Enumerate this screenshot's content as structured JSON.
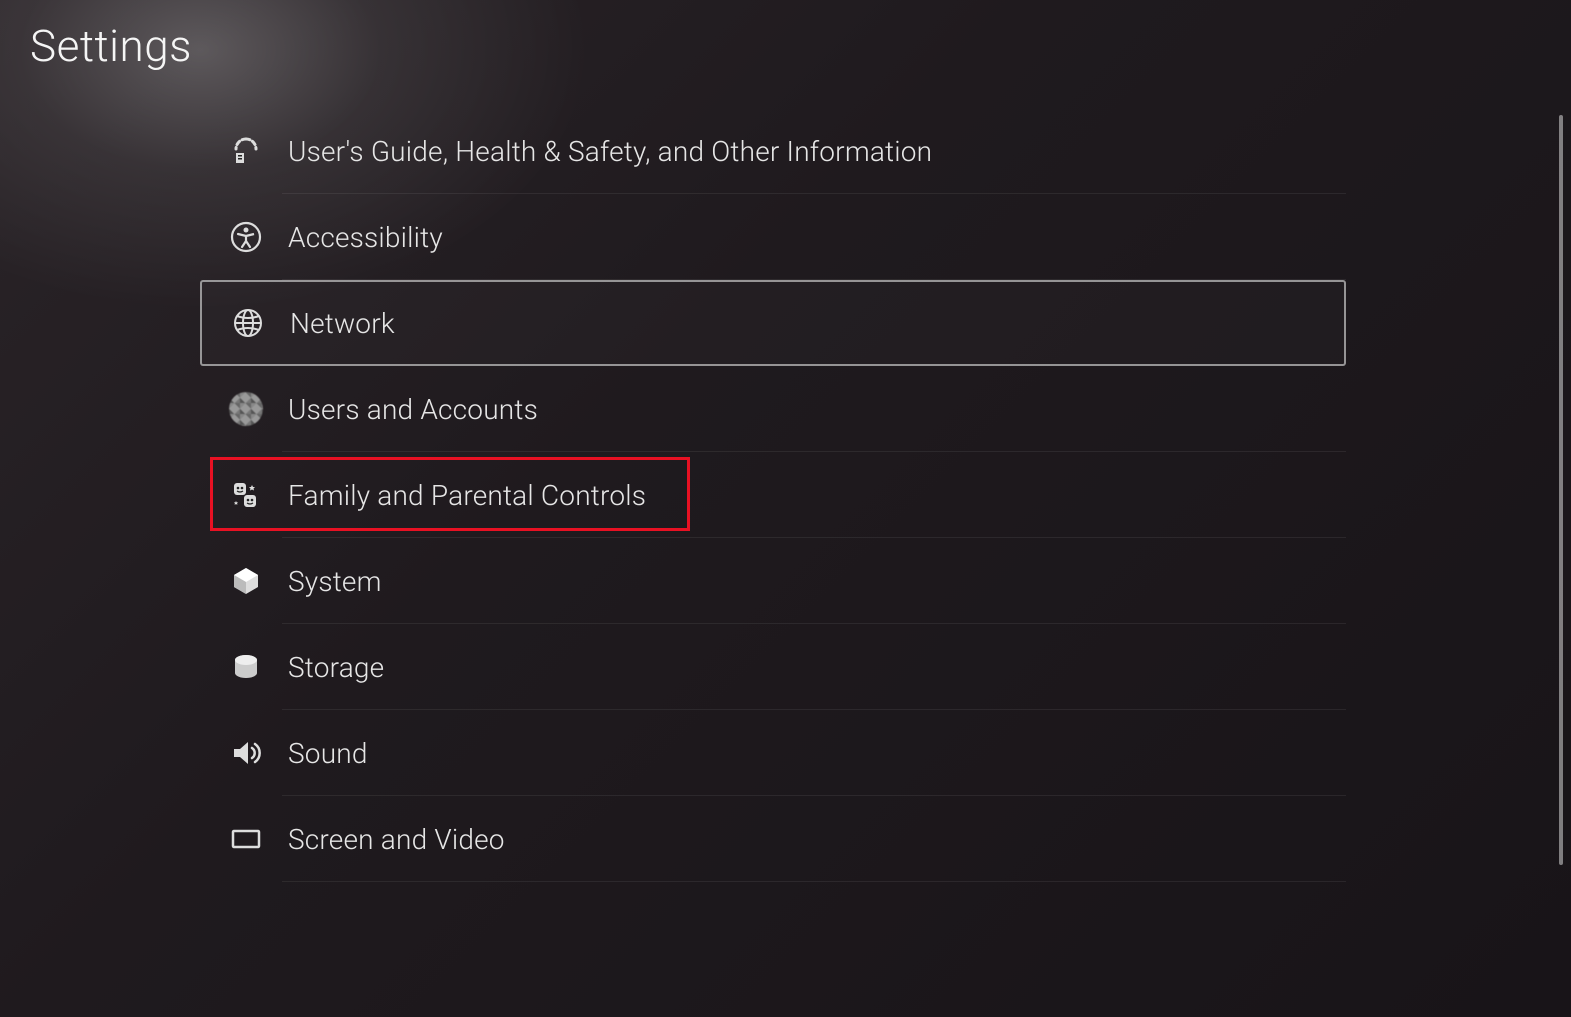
{
  "header": {
    "title": "Settings"
  },
  "menu": {
    "items": [
      {
        "id": "guide",
        "label": "User's Guide, Health & Safety, and Other Information",
        "icon": "guide-icon",
        "selected": false,
        "highlighted": false
      },
      {
        "id": "accessibility",
        "label": "Accessibility",
        "icon": "accessibility-icon",
        "selected": false,
        "highlighted": false
      },
      {
        "id": "network",
        "label": "Network",
        "icon": "globe-icon",
        "selected": true,
        "highlighted": false
      },
      {
        "id": "users",
        "label": "Users and Accounts",
        "icon": "avatar-icon",
        "selected": false,
        "highlighted": false
      },
      {
        "id": "family",
        "label": "Family and Parental Controls",
        "icon": "family-icon",
        "selected": false,
        "highlighted": true
      },
      {
        "id": "system",
        "label": "System",
        "icon": "cube-icon",
        "selected": false,
        "highlighted": false
      },
      {
        "id": "storage",
        "label": "Storage",
        "icon": "storage-icon",
        "selected": false,
        "highlighted": false
      },
      {
        "id": "sound",
        "label": "Sound",
        "icon": "speaker-icon",
        "selected": false,
        "highlighted": false
      },
      {
        "id": "screen",
        "label": "Screen and Video",
        "icon": "screen-icon",
        "selected": false,
        "highlighted": false
      }
    ]
  }
}
